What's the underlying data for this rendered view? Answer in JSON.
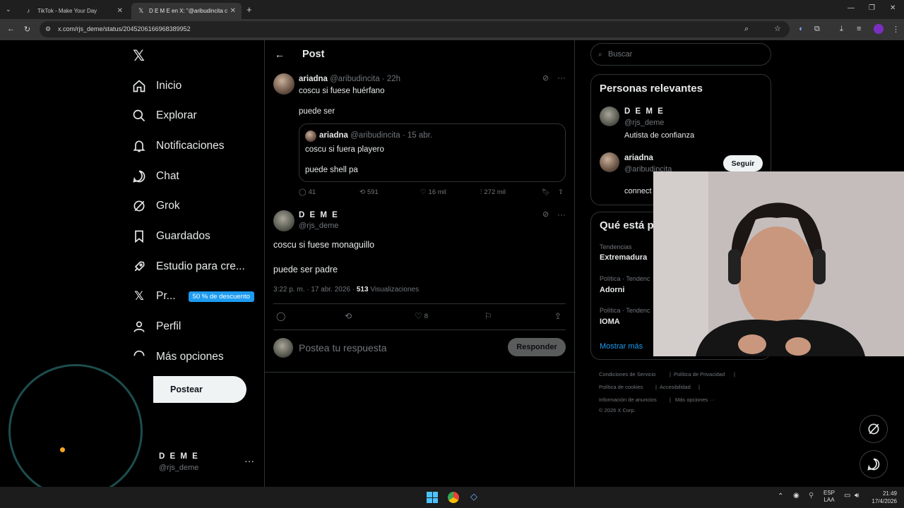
{
  "browser": {
    "tabs": [
      {
        "title": "TikTok - Make Your Day",
        "active": false
      },
      {
        "title": "D E M E en X: \"@aribudincita c",
        "active": true
      }
    ],
    "url": "x.com/rjs_deme/status/2045206166968389952"
  },
  "nav": {
    "items": [
      {
        "label": "Inicio",
        "icon": "home-icon"
      },
      {
        "label": "Explorar",
        "icon": "search-icon"
      },
      {
        "label": "Notificaciones",
        "icon": "bell-icon"
      },
      {
        "label": "Chat",
        "icon": "chat-icon"
      },
      {
        "label": "Grok",
        "icon": "grok-icon"
      },
      {
        "label": "Guardados",
        "icon": "bookmark-icon"
      },
      {
        "label": "Estudio para cre...",
        "icon": "rocket-icon"
      },
      {
        "label": "Pr...",
        "icon": "x-logo-icon"
      },
      {
        "label": "Perfil",
        "icon": "person-icon"
      },
      {
        "label": "Más opciones",
        "icon": "more-circle-icon"
      }
    ],
    "premium_badge": "50 % de descuento",
    "post_button": "Postear",
    "account": {
      "name": "D E M E",
      "handle": "@rjs_deme"
    }
  },
  "post": {
    "header": "Post",
    "parent": {
      "name": "ariadna",
      "handle": "@aribudincita",
      "time": "22h",
      "line1": "coscu si fuese huérfano",
      "line2": "puede ser",
      "quote": {
        "name": "ariadna",
        "handle": "@aribudincita",
        "date": "15 abr.",
        "line1": "coscu si fuera playero",
        "line2": "puede shell pa"
      },
      "stats": {
        "replies": "41",
        "reposts": "591",
        "likes": "16 mil",
        "views": "272 mil"
      }
    },
    "main": {
      "name": "D E M E",
      "handle": "@rjs_deme",
      "line1": "coscu si fuese monaguillo",
      "line2": "puede ser padre",
      "timestamp": "3:22 p. m. · 17 abr. 2026 ·",
      "views_count": "513",
      "views_label": "Visualizaciones",
      "likes": "8"
    },
    "reply": {
      "placeholder": "Postea tu respuesta",
      "button": "Responder"
    }
  },
  "sidebar": {
    "search_placeholder": "Buscar",
    "relevant_title": "Personas relevantes",
    "people": [
      {
        "name": "D E M E",
        "handle": "@rjs_deme",
        "bio": "Autista de confianza"
      },
      {
        "name": "ariadna",
        "handle": "@aribudincita",
        "bio": "connect",
        "follow": "Seguir"
      }
    ],
    "trends_title": "Qué está p",
    "trends": [
      {
        "category": "Tendencias",
        "name": "Extremadura"
      },
      {
        "category": "Política · Tendenc",
        "name": "Adorni"
      },
      {
        "category": "Política · Tendenc",
        "name": "IOMA"
      }
    ],
    "show_more": "Mostrar más",
    "footer": {
      "row1": [
        "Condiciones de Servicio",
        "|",
        "Política de Privacidad",
        "|"
      ],
      "row2": [
        "Política de cookies",
        "|",
        "Accesibilidad",
        "|"
      ],
      "row3": [
        "Información de anuncios",
        "|",
        "Más opciones ···"
      ],
      "copyright": "© 2026 X Corp."
    }
  },
  "taskbar": {
    "lang1": "ESP",
    "lang2": "LAA",
    "time": "21:49",
    "date": "17/4/2026"
  },
  "colors": {
    "accent": "#1d9bf0",
    "background": "#000000",
    "border": "#2f3336",
    "muted": "#71767b"
  }
}
